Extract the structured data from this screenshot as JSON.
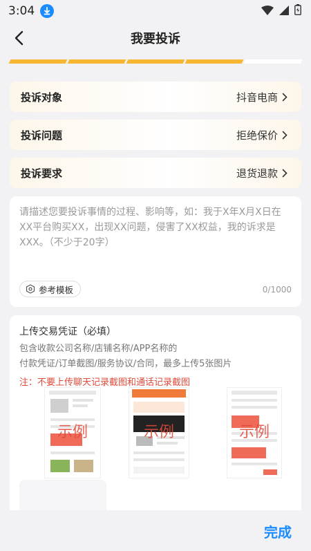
{
  "status_bar": {
    "time": "3:04"
  },
  "nav": {
    "title": "我要投诉"
  },
  "progress": {
    "total_steps": 5,
    "completed_steps": 4
  },
  "rows": [
    {
      "label": "投诉对象",
      "value": "抖音电商"
    },
    {
      "label": "投诉问题",
      "value": "拒绝保价"
    },
    {
      "label": "投诉要求",
      "value": "退货退款"
    }
  ],
  "description": {
    "placeholder": "请描述您要投诉事情的过程、影响等，如：我于X年X月X日在XX平台购买XX，出现XX问题，侵害了XX权益，我的诉求是XXX。（不少于20字）",
    "template_button": "参考模板",
    "char_count": "0/1000"
  },
  "upload": {
    "title": "上传交易凭证（必填）",
    "desc_line1": "包含收款公司名称/店铺名称/APP名称的",
    "desc_line2": "付款凭证/订单截图/服务协议/合同，最多上传5张图片",
    "note": "注：不要上传聊天记录截图和通话记录截图",
    "samples": [
      {
        "label": "示例"
      },
      {
        "label": "示例"
      },
      {
        "label": "示例"
      }
    ]
  },
  "footer": {
    "done_label": "完成"
  },
  "colors": {
    "accent": "#1a8cff",
    "progress": "#f7b733",
    "warning": "#e04a3a"
  }
}
